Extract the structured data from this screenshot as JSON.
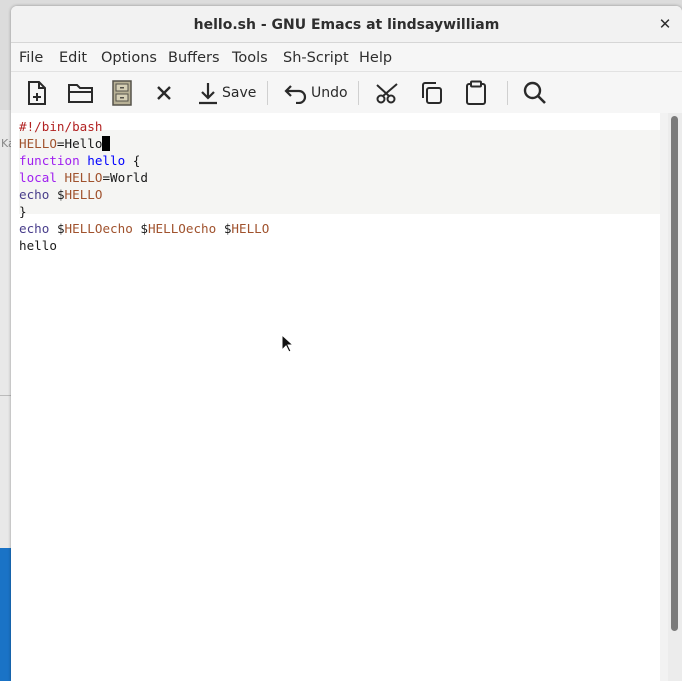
{
  "window": {
    "title": "hello.sh - GNU Emacs at lindsaywilliam",
    "close_symbol": "✕"
  },
  "desktop": {
    "glyph": "Ka"
  },
  "menubar": {
    "items": [
      "File",
      "Edit",
      "Options",
      "Buffers",
      "Tools",
      "Sh-Script",
      "Help"
    ]
  },
  "toolbar": {
    "new": "new-file-icon",
    "open": "open-folder-icon",
    "dired": "dired-cabinet-icon",
    "kill": "close-buffer-icon",
    "save_label": "Save",
    "undo_label": "Undo",
    "cut": "cut-icon",
    "copy": "copy-icon",
    "paste": "paste-icon",
    "search": "search-icon"
  },
  "editor": {
    "l1": "#!/bin/bash",
    "l2_var": "HELLO",
    "l2_eq": "=",
    "l2_val": "Hello",
    "l3_kw": "function",
    "l3_fn": "hello",
    "l3_brace": " {",
    "l4_kw": "local",
    "l4_var": "HELLO",
    "l4_eq": "=",
    "l4_val": "World",
    "l5_kw": "echo",
    "l5_dollar": "$",
    "l5_var": "HELLO",
    "l6": "}",
    "l7_kw": "echo",
    "l7_dollar1": "$",
    "l7_var1": "HELLOecho",
    "l7_dollar2": "$",
    "l7_var2": "HELLOecho",
    "l7_dollar3": "$",
    "l7_var3": "HELLO",
    "l8": "hello"
  },
  "colors": {
    "comment": "#b22222",
    "variable": "#a0522d",
    "keyword": "#a020f0",
    "function": "#0000ff",
    "builtin": "#483d8b"
  }
}
